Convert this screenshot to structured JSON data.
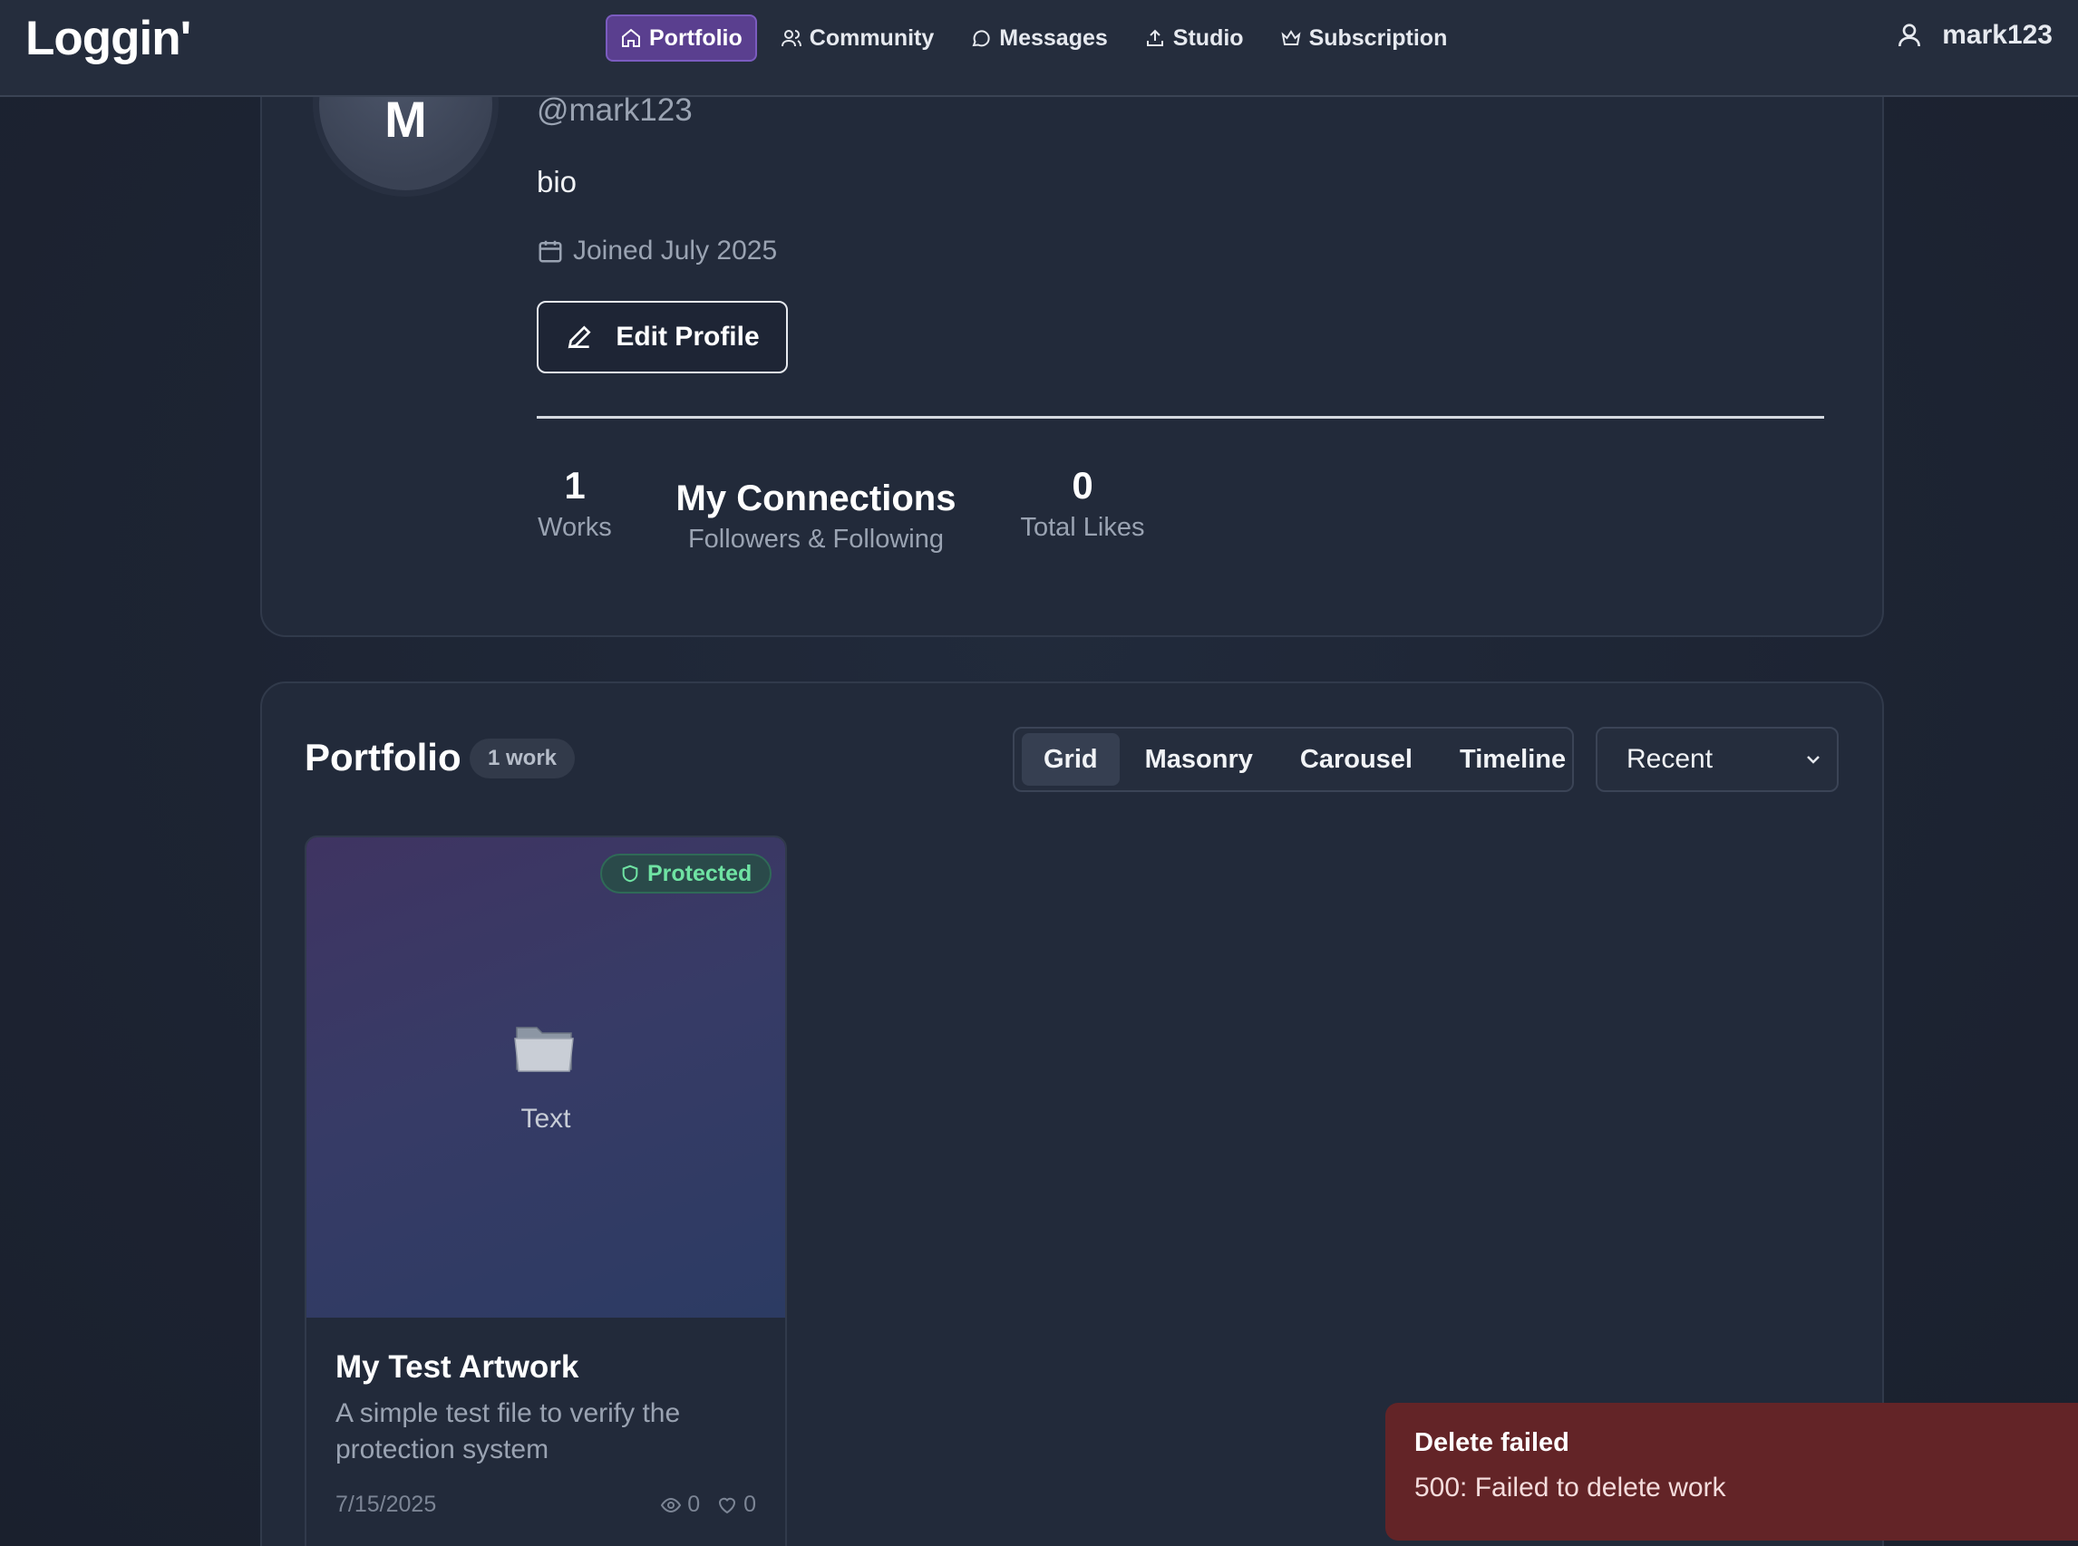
{
  "nav": {
    "logo": "Loggin'",
    "items": [
      {
        "label": "Portfolio",
        "icon": "home-icon",
        "active": true
      },
      {
        "label": "Community",
        "icon": "users-icon"
      },
      {
        "label": "Messages",
        "icon": "message-icon"
      },
      {
        "label": "Studio",
        "icon": "upload-icon"
      },
      {
        "label": "Subscription",
        "icon": "crown-icon"
      }
    ],
    "user": "mark123"
  },
  "profile": {
    "avatar_initial": "M",
    "handle": "@mark123",
    "bio": "bio",
    "joined": "Joined July 2025",
    "edit_label": "Edit Profile",
    "stats": {
      "works": {
        "value": "1",
        "label": "Works"
      },
      "connections": {
        "value": "My Connections",
        "label": "Followers & Following"
      },
      "likes": {
        "value": "0",
        "label": "Total Likes"
      }
    }
  },
  "portfolio": {
    "title": "Portfolio",
    "count_badge": "1 work",
    "views": [
      "Grid",
      "Masonry",
      "Carousel",
      "Timeline"
    ],
    "active_view": "Grid",
    "sort": "Recent",
    "works": [
      {
        "badge": "Protected",
        "type_label": "Text",
        "title": "My Test Artwork",
        "description": "A simple test file to verify the protection system",
        "date": "7/15/2025",
        "views": "0",
        "likes": "0"
      }
    ]
  },
  "toast": {
    "title": "Delete failed",
    "message": "500: Failed to delete work"
  },
  "colors": {
    "background": "#1d2433",
    "card": "#222a3a",
    "accent": "#5a3f8f",
    "protected": "#6fe3a3",
    "toast": "#632427"
  }
}
